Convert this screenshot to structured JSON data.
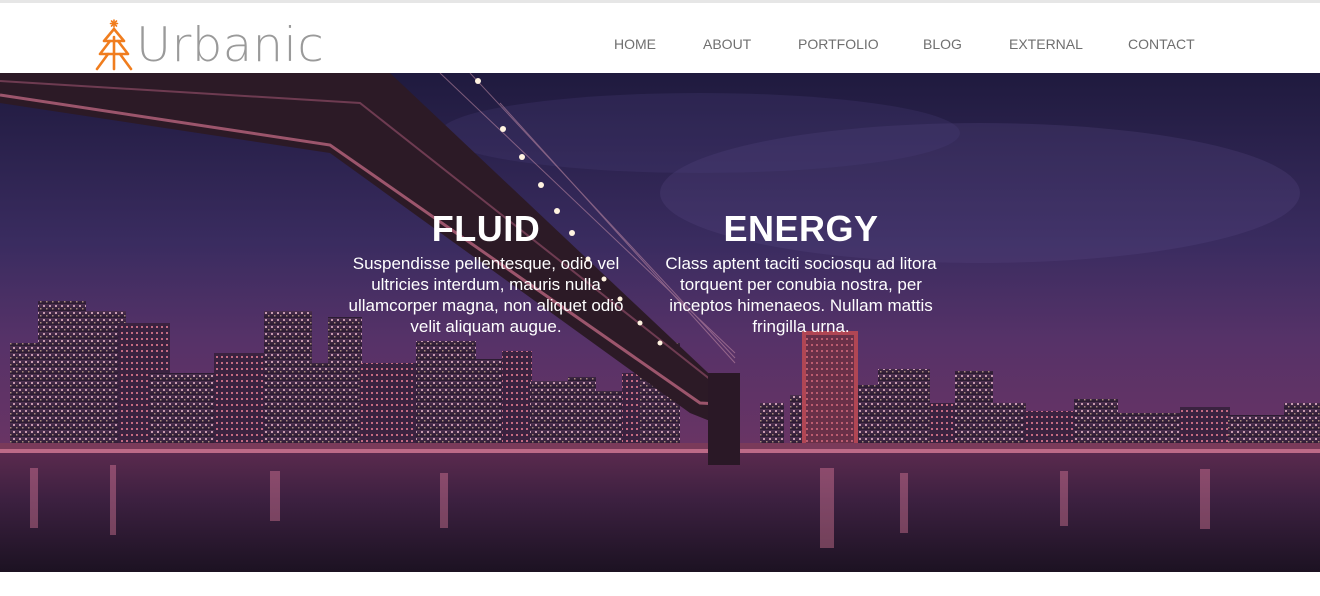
{
  "brand": {
    "name": "Urbanic",
    "accent_color": "#f07d1e",
    "logo_icon": "tree-icon"
  },
  "nav": {
    "items": [
      {
        "label": "HOME"
      },
      {
        "label": "ABOUT"
      },
      {
        "label": "PORTFOLIO"
      },
      {
        "label": "BLOG"
      },
      {
        "label": "EXTERNAL"
      },
      {
        "label": "CONTACT"
      }
    ]
  },
  "hero": {
    "background_image": "city-bridge-night-image",
    "features": [
      {
        "title": "FLUID",
        "text": "Suspendisse pellentesque, odio vel ultricies interdum, mauris nulla ullamcorper magna, non aliquet odio velit aliquam augue."
      },
      {
        "title": "ENERGY",
        "text": "Class aptent taciti sociosqu ad litora torquent per conubia nostra, per inceptos himenaeos. Nullam mattis fringilla urna."
      }
    ]
  }
}
